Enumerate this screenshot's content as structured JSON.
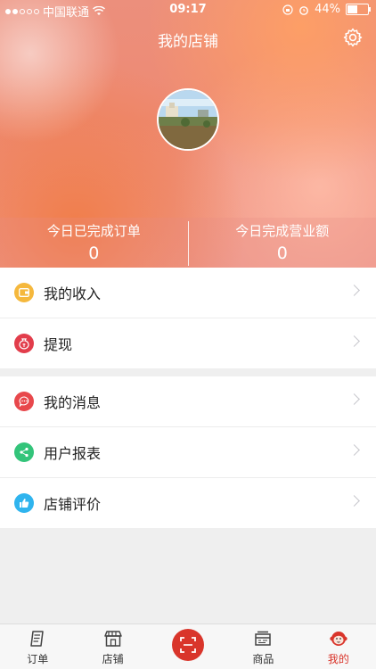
{
  "status_bar": {
    "carrier": "中国联通",
    "time": "09:17",
    "battery": "44%"
  },
  "header": {
    "title": "我的店铺"
  },
  "stats": [
    {
      "label": "今日已完成订单",
      "value": "0"
    },
    {
      "label": "今日完成营业额",
      "value": "0"
    }
  ],
  "menu_group_1": [
    {
      "label": "我的收入",
      "icon": "wallet-icon",
      "color": "#f5b83d"
    },
    {
      "label": "提现",
      "icon": "money-bag-icon",
      "color": "#e23d4b"
    }
  ],
  "menu_group_2": [
    {
      "label": "我的消息",
      "icon": "chat-icon",
      "color": "#e8484c"
    },
    {
      "label": "用户报表",
      "icon": "share-icon",
      "color": "#33c47a"
    },
    {
      "label": "店铺评价",
      "icon": "thumbs-up-icon",
      "color": "#2fb4ee"
    }
  ],
  "tabs": [
    {
      "label": "订单",
      "icon": "orders-icon"
    },
    {
      "label": "店铺",
      "icon": "store-icon"
    },
    {
      "label": "",
      "icon": "scan-icon"
    },
    {
      "label": "商品",
      "icon": "goods-icon"
    },
    {
      "label": "我的",
      "icon": "monkey-avatar-icon",
      "active": true
    }
  ],
  "colors": {
    "accent": "#d9352b"
  }
}
